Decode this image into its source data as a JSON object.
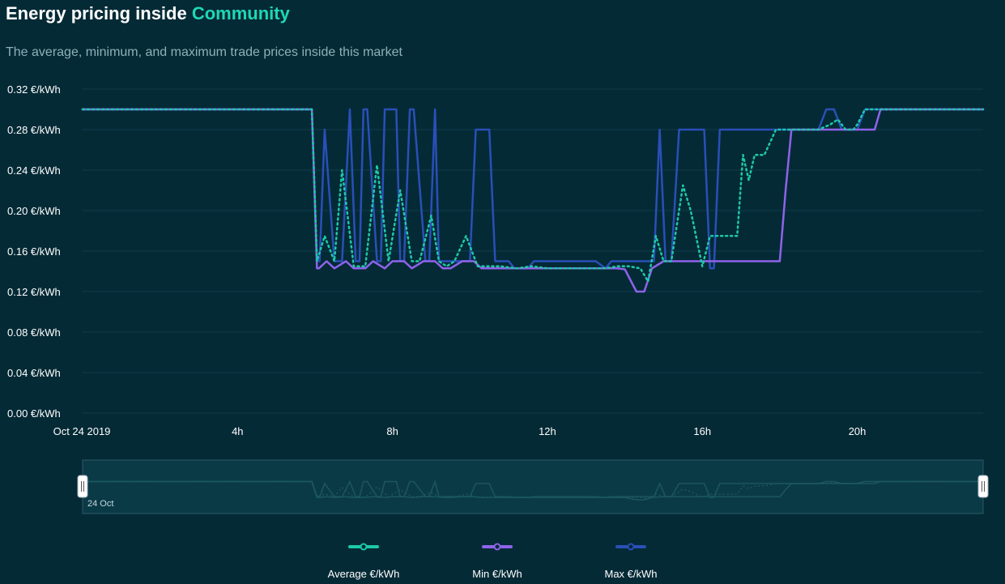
{
  "header": {
    "title_prefix": "Energy pricing inside",
    "title_accent": "Community",
    "subtitle": "The average, minimum, and maximum trade prices inside this market"
  },
  "colors": {
    "background": "#042a36",
    "gridline": "#0f3c49",
    "average": "#1ec9a8",
    "min": "#8e63ea",
    "max": "#2a4fb8",
    "accent": "#1fd8b4"
  },
  "navigator": {
    "label": "24 Oct"
  },
  "chart_data": {
    "type": "line",
    "title": "",
    "xlabel": "",
    "ylabel": "",
    "x_unit": "hours since Oct 24 2019 00:00",
    "xlim": [
      0,
      23.25
    ],
    "ylim": [
      0,
      0.32
    ],
    "y_ticks": [
      {
        "value": 0.32,
        "label": "0.32 €/kWh"
      },
      {
        "value": 0.28,
        "label": "0.28 €/kWh"
      },
      {
        "value": 0.24,
        "label": "0.24 €/kWh"
      },
      {
        "value": 0.2,
        "label": "0.20 €/kWh"
      },
      {
        "value": 0.16,
        "label": "0.16 €/kWh"
      },
      {
        "value": 0.12,
        "label": "0.12 €/kWh"
      },
      {
        "value": 0.08,
        "label": "0.08 €/kWh"
      },
      {
        "value": 0.04,
        "label": "0.04 €/kWh"
      },
      {
        "value": 0.0,
        "label": "0.00 €/kWh"
      }
    ],
    "x_ticks": [
      {
        "value": 0,
        "label": "Oct 24 2019"
      },
      {
        "value": 4,
        "label": "4h"
      },
      {
        "value": 8,
        "label": "8h"
      },
      {
        "value": 12,
        "label": "12h"
      },
      {
        "value": 16,
        "label": "16h"
      },
      {
        "value": 20,
        "label": "20h"
      }
    ],
    "grid": true,
    "legend_position": "bottom",
    "series": [
      {
        "name": "Max €/kWh",
        "color": "#2a4fb8",
        "dash": "solid",
        "x": [
          0,
          5.92,
          6.05,
          6.12,
          6.25,
          6.5,
          6.7,
          6.9,
          7.05,
          7.15,
          7.25,
          7.35,
          7.6,
          7.7,
          7.8,
          8.1,
          8.2,
          8.3,
          8.45,
          8.55,
          8.85,
          8.95,
          9.1,
          9.2,
          9.3,
          9.45,
          9.55,
          10.0,
          10.15,
          10.5,
          10.65,
          11.0,
          11.15,
          11.5,
          11.65,
          13.25,
          13.5,
          13.65,
          14.75,
          14.9,
          15.05,
          15.2,
          15.4,
          15.55,
          16.05,
          16.2,
          16.3,
          16.45,
          18.0,
          19.0,
          19.2,
          19.4,
          19.6,
          19.75,
          20.0,
          20.2,
          20.35,
          23.25
        ],
        "y": [
          0.3,
          0.3,
          0.15,
          0.15,
          0.28,
          0.15,
          0.15,
          0.3,
          0.15,
          0.15,
          0.3,
          0.3,
          0.15,
          0.15,
          0.3,
          0.3,
          0.15,
          0.15,
          0.3,
          0.3,
          0.15,
          0.15,
          0.3,
          0.15,
          0.15,
          0.15,
          0.15,
          0.15,
          0.28,
          0.28,
          0.15,
          0.15,
          0.143,
          0.143,
          0.15,
          0.15,
          0.143,
          0.15,
          0.15,
          0.28,
          0.15,
          0.15,
          0.28,
          0.28,
          0.28,
          0.143,
          0.143,
          0.28,
          0.28,
          0.28,
          0.3,
          0.3,
          0.28,
          0.28,
          0.28,
          0.3,
          0.3,
          0.3
        ]
      },
      {
        "name": "Min €/kWh",
        "color": "#8e63ea",
        "dash": "solid",
        "x": [
          0,
          5.92,
          6.05,
          6.1,
          6.3,
          6.5,
          6.8,
          7.0,
          7.3,
          7.5,
          7.8,
          8.0,
          8.3,
          8.5,
          8.8,
          9.1,
          9.3,
          9.5,
          9.8,
          10.1,
          10.3,
          13.8,
          14.0,
          14.3,
          14.5,
          14.7,
          15.0,
          15.2,
          15.5,
          16.0,
          18.0,
          18.15,
          18.3,
          19.8,
          20.45,
          20.6,
          23.25
        ],
        "y": [
          0.3,
          0.3,
          0.143,
          0.143,
          0.15,
          0.143,
          0.15,
          0.143,
          0.143,
          0.15,
          0.143,
          0.15,
          0.15,
          0.143,
          0.15,
          0.15,
          0.143,
          0.143,
          0.15,
          0.15,
          0.143,
          0.143,
          0.142,
          0.12,
          0.12,
          0.143,
          0.15,
          0.15,
          0.15,
          0.15,
          0.15,
          0.22,
          0.28,
          0.28,
          0.28,
          0.3,
          0.3
        ]
      },
      {
        "name": "Average €/kWh",
        "color": "#1ec9a8",
        "dash": "dotted",
        "x": [
          0,
          5.92,
          6.05,
          6.25,
          6.5,
          6.7,
          7.0,
          7.3,
          7.6,
          7.9,
          8.2,
          8.5,
          8.7,
          9.0,
          9.2,
          9.4,
          9.6,
          9.9,
          10.2,
          10.5,
          10.8,
          11.2,
          11.6,
          12.0,
          12.5,
          13.0,
          13.5,
          13.8,
          14.1,
          14.4,
          14.6,
          14.8,
          15.0,
          15.2,
          15.5,
          15.7,
          16.0,
          16.2,
          16.5,
          16.9,
          17.05,
          17.2,
          17.35,
          17.6,
          17.9,
          18.2,
          19.0,
          19.3,
          19.5,
          19.7,
          19.9,
          20.0,
          20.2,
          20.4,
          23.25
        ],
        "y": [
          0.3,
          0.3,
          0.15,
          0.175,
          0.15,
          0.24,
          0.145,
          0.145,
          0.245,
          0.15,
          0.22,
          0.15,
          0.15,
          0.195,
          0.15,
          0.145,
          0.15,
          0.175,
          0.145,
          0.145,
          0.145,
          0.143,
          0.145,
          0.143,
          0.143,
          0.143,
          0.143,
          0.145,
          0.145,
          0.143,
          0.13,
          0.175,
          0.15,
          0.15,
          0.225,
          0.2,
          0.145,
          0.175,
          0.175,
          0.175,
          0.255,
          0.23,
          0.255,
          0.255,
          0.28,
          0.28,
          0.28,
          0.285,
          0.29,
          0.28,
          0.28,
          0.285,
          0.3,
          0.3,
          0.3
        ]
      }
    ]
  },
  "legend": [
    {
      "name": "Average €/kWh",
      "color": "#1ec9a8"
    },
    {
      "name": "Min €/kWh",
      "color": "#8e63ea"
    },
    {
      "name": "Max €/kWh",
      "color": "#2a4fb8"
    }
  ]
}
